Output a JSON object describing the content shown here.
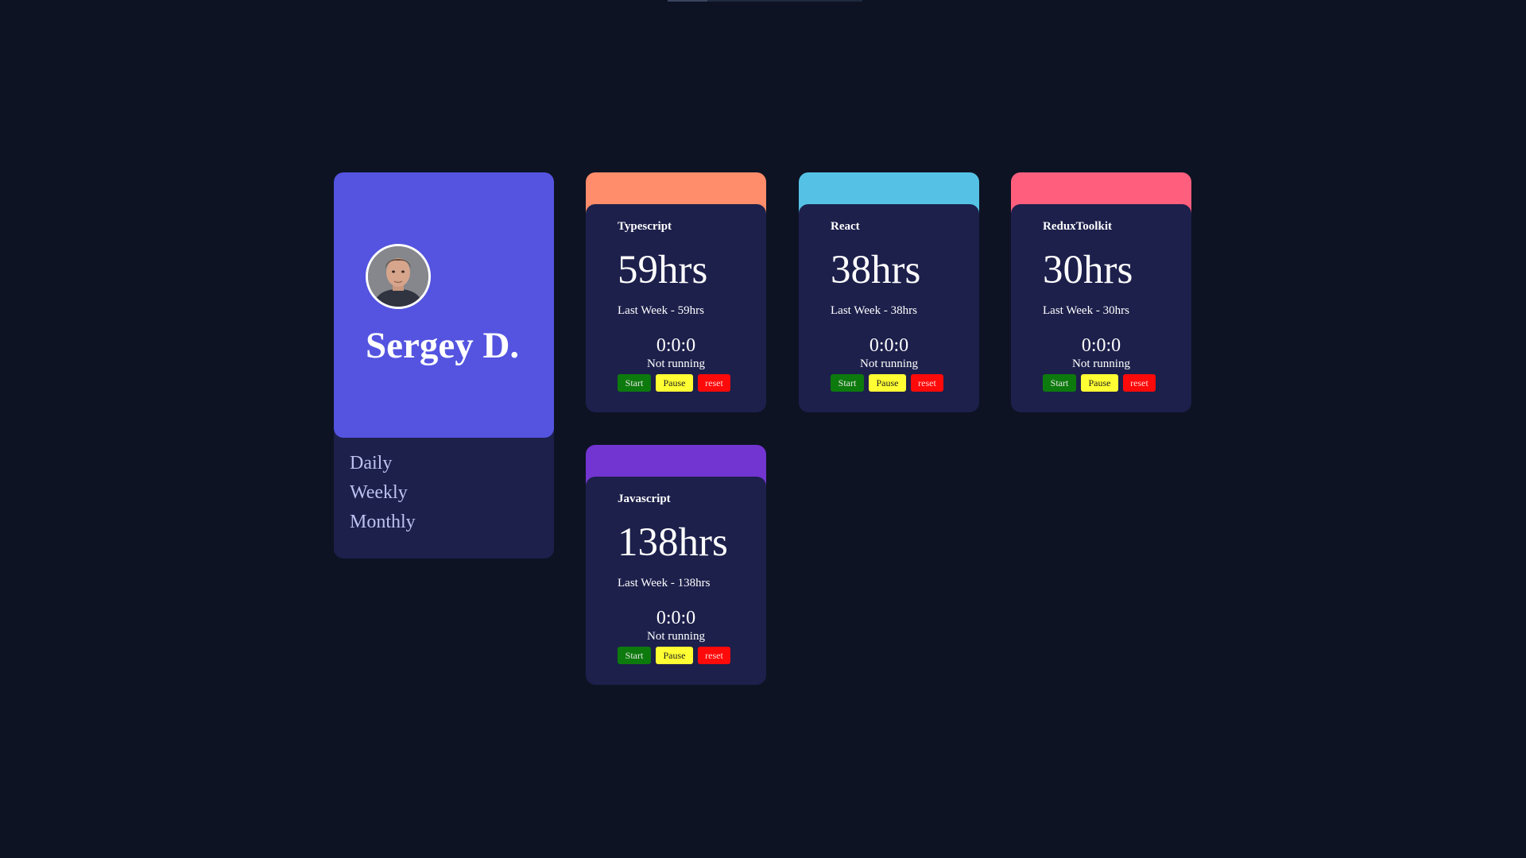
{
  "profile": {
    "name": "Sergey D.",
    "periods": [
      "Daily",
      "Weekly",
      "Monthly"
    ]
  },
  "cards": [
    {
      "title": "Typescript",
      "hours": "59hrs",
      "last_week": "Last Week - 59hrs",
      "timer": "0:0:0",
      "status": "Not running",
      "start": "Start",
      "pause": "Pause",
      "reset": "reset",
      "color": "#ff8c6a"
    },
    {
      "title": "React",
      "hours": "38hrs",
      "last_week": "Last Week - 38hrs",
      "timer": "0:0:0",
      "status": "Not running",
      "start": "Start",
      "pause": "Pause",
      "reset": "reset",
      "color": "#55c2e5"
    },
    {
      "title": "ReduxToolkit",
      "hours": "30hrs",
      "last_week": "Last Week - 30hrs",
      "timer": "0:0:0",
      "status": "Not running",
      "start": "Start",
      "pause": "Pause",
      "reset": "reset",
      "color": "#ff5e7d"
    },
    {
      "title": "Javascript",
      "hours": "138hrs",
      "last_week": "Last Week - 138hrs",
      "timer": "0:0:0",
      "status": "Not running",
      "start": "Start",
      "pause": "Pause",
      "reset": "reset",
      "color": "#7235d1"
    }
  ],
  "colors": {
    "background": "#0d1323",
    "profile_accent": "#5454e0",
    "card_body": "#1d204b",
    "start_button": "#0d7a0d",
    "pause_button": "#ffff33",
    "reset_button": "#ff0a0a"
  }
}
